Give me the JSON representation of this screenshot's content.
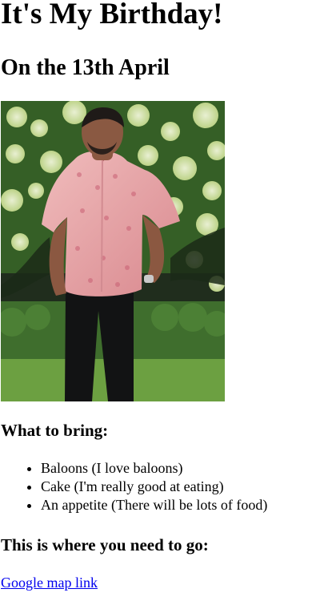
{
  "page": {
    "title": "It's My Birthday!",
    "subtitle": "On the 13th April",
    "photo_icon": "birthday-person-photo"
  },
  "bring": {
    "heading": "What to bring:",
    "items": [
      "Baloons (I love baloons)",
      "Cake (I'm really good at eating)",
      "An appetite (There will be lots of food)"
    ]
  },
  "location": {
    "heading": "This is where you need to go:",
    "link_text": "Google map link"
  },
  "colors": {
    "text": "#000000",
    "link": "#0000ee",
    "background": "#ffffff"
  }
}
